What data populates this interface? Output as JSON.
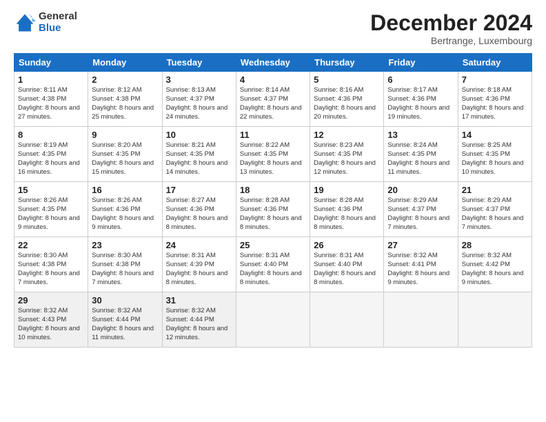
{
  "logo": {
    "general": "General",
    "blue": "Blue"
  },
  "header": {
    "month": "December 2024",
    "location": "Bertrange, Luxembourg"
  },
  "weekdays": [
    "Sunday",
    "Monday",
    "Tuesday",
    "Wednesday",
    "Thursday",
    "Friday",
    "Saturday"
  ],
  "weeks": [
    [
      {
        "day": "1",
        "sunrise": "8:11 AM",
        "sunset": "4:38 PM",
        "daylight": "8 hours and 27 minutes."
      },
      {
        "day": "2",
        "sunrise": "8:12 AM",
        "sunset": "4:38 PM",
        "daylight": "8 hours and 25 minutes."
      },
      {
        "day": "3",
        "sunrise": "8:13 AM",
        "sunset": "4:37 PM",
        "daylight": "8 hours and 24 minutes."
      },
      {
        "day": "4",
        "sunrise": "8:14 AM",
        "sunset": "4:37 PM",
        "daylight": "8 hours and 22 minutes."
      },
      {
        "day": "5",
        "sunrise": "8:16 AM",
        "sunset": "4:36 PM",
        "daylight": "8 hours and 20 minutes."
      },
      {
        "day": "6",
        "sunrise": "8:17 AM",
        "sunset": "4:36 PM",
        "daylight": "8 hours and 19 minutes."
      },
      {
        "day": "7",
        "sunrise": "8:18 AM",
        "sunset": "4:36 PM",
        "daylight": "8 hours and 17 minutes."
      }
    ],
    [
      {
        "day": "8",
        "sunrise": "8:19 AM",
        "sunset": "4:35 PM",
        "daylight": "8 hours and 16 minutes."
      },
      {
        "day": "9",
        "sunrise": "8:20 AM",
        "sunset": "4:35 PM",
        "daylight": "8 hours and 15 minutes."
      },
      {
        "day": "10",
        "sunrise": "8:21 AM",
        "sunset": "4:35 PM",
        "daylight": "8 hours and 14 minutes."
      },
      {
        "day": "11",
        "sunrise": "8:22 AM",
        "sunset": "4:35 PM",
        "daylight": "8 hours and 13 minutes."
      },
      {
        "day": "12",
        "sunrise": "8:23 AM",
        "sunset": "4:35 PM",
        "daylight": "8 hours and 12 minutes."
      },
      {
        "day": "13",
        "sunrise": "8:24 AM",
        "sunset": "4:35 PM",
        "daylight": "8 hours and 11 minutes."
      },
      {
        "day": "14",
        "sunrise": "8:25 AM",
        "sunset": "4:35 PM",
        "daylight": "8 hours and 10 minutes."
      }
    ],
    [
      {
        "day": "15",
        "sunrise": "8:26 AM",
        "sunset": "4:35 PM",
        "daylight": "8 hours and 9 minutes."
      },
      {
        "day": "16",
        "sunrise": "8:26 AM",
        "sunset": "4:36 PM",
        "daylight": "8 hours and 9 minutes."
      },
      {
        "day": "17",
        "sunrise": "8:27 AM",
        "sunset": "4:36 PM",
        "daylight": "8 hours and 8 minutes."
      },
      {
        "day": "18",
        "sunrise": "8:28 AM",
        "sunset": "4:36 PM",
        "daylight": "8 hours and 8 minutes."
      },
      {
        "day": "19",
        "sunrise": "8:28 AM",
        "sunset": "4:36 PM",
        "daylight": "8 hours and 8 minutes."
      },
      {
        "day": "20",
        "sunrise": "8:29 AM",
        "sunset": "4:37 PM",
        "daylight": "8 hours and 7 minutes."
      },
      {
        "day": "21",
        "sunrise": "8:29 AM",
        "sunset": "4:37 PM",
        "daylight": "8 hours and 7 minutes."
      }
    ],
    [
      {
        "day": "22",
        "sunrise": "8:30 AM",
        "sunset": "4:38 PM",
        "daylight": "8 hours and 7 minutes."
      },
      {
        "day": "23",
        "sunrise": "8:30 AM",
        "sunset": "4:38 PM",
        "daylight": "8 hours and 7 minutes."
      },
      {
        "day": "24",
        "sunrise": "8:31 AM",
        "sunset": "4:39 PM",
        "daylight": "8 hours and 8 minutes."
      },
      {
        "day": "25",
        "sunrise": "8:31 AM",
        "sunset": "4:40 PM",
        "daylight": "8 hours and 8 minutes."
      },
      {
        "day": "26",
        "sunrise": "8:31 AM",
        "sunset": "4:40 PM",
        "daylight": "8 hours and 8 minutes."
      },
      {
        "day": "27",
        "sunrise": "8:32 AM",
        "sunset": "4:41 PM",
        "daylight": "8 hours and 9 minutes."
      },
      {
        "day": "28",
        "sunrise": "8:32 AM",
        "sunset": "4:42 PM",
        "daylight": "8 hours and 9 minutes."
      }
    ],
    [
      {
        "day": "29",
        "sunrise": "8:32 AM",
        "sunset": "4:43 PM",
        "daylight": "8 hours and 10 minutes."
      },
      {
        "day": "30",
        "sunrise": "8:32 AM",
        "sunset": "4:44 PM",
        "daylight": "8 hours and 11 minutes."
      },
      {
        "day": "31",
        "sunrise": "8:32 AM",
        "sunset": "4:44 PM",
        "daylight": "8 hours and 12 minutes."
      },
      null,
      null,
      null,
      null
    ]
  ]
}
